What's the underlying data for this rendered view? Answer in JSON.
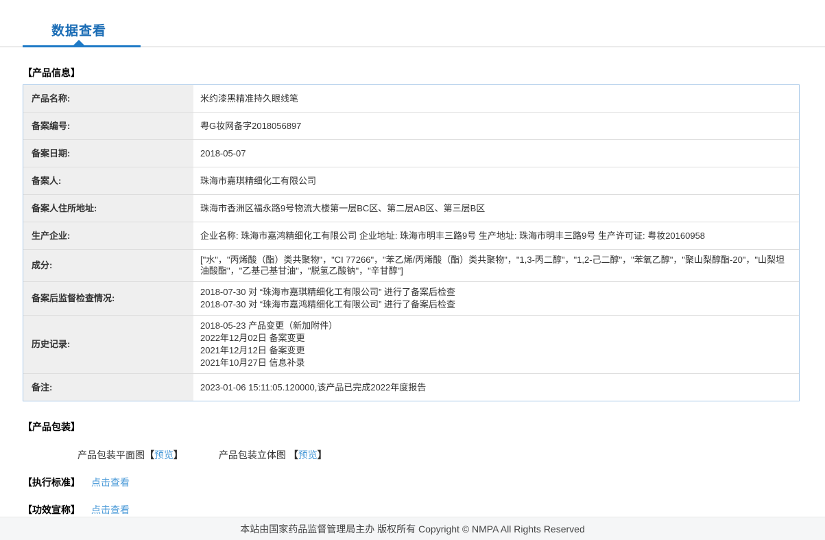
{
  "tab": {
    "label": "数据查看"
  },
  "colors": {
    "tab_blue": "#1a6cb5",
    "underline_blue": "#1f7ac6",
    "link_blue": "#4a9ad8",
    "table_border": "#a9c9e8",
    "label_bg": "#efefef",
    "row_divider": "#dddddd",
    "footer_bg": "#f5f6f7"
  },
  "product_info": {
    "section_title": "【产品信息】",
    "rows": [
      {
        "label": "产品名称:",
        "lines": [
          "米约漆黑精准持久眼线笔"
        ]
      },
      {
        "label": "备案编号:",
        "lines": [
          "粤G妆网备字2018056897"
        ]
      },
      {
        "label": "备案日期:",
        "lines": [
          "2018-05-07"
        ]
      },
      {
        "label": "备案人:",
        "lines": [
          "珠海市嘉琪精细化工有限公司"
        ]
      },
      {
        "label": "备案人住所地址:",
        "lines": [
          "珠海市香洲区福永路9号物流大楼第一层BC区、第二层AB区、第三层B区"
        ]
      },
      {
        "label": "生产企业:",
        "lines": [
          "企业名称: 珠海市嘉鸿精细化工有限公司 企业地址: 珠海市明丰三路9号 生产地址: 珠海市明丰三路9号 生产许可证: 粤妆20160958"
        ]
      },
      {
        "label": "成分:",
        "lines": [
          "[\"水\"，\"丙烯酸（酯）类共聚物\"，\"CI 77266\"，\"苯乙烯/丙烯酸（酯）类共聚物\"，\"1,3-丙二醇\"，\"1,2-己二醇\"，\"苯氧乙醇\"，\"聚山梨醇酯-20\"，\"山梨坦油酸酯\"，\"乙基己基甘油\"，\"脱氢乙酸钠\"，\"辛甘醇\"]"
        ]
      },
      {
        "label": "备案后监督检查情况:",
        "lines": [
          "2018-07-30 对 “珠海市嘉琪精细化工有限公司” 进行了备案后检查",
          "2018-07-30 对 “珠海市嘉鸿精细化工有限公司” 进行了备案后检查"
        ]
      },
      {
        "label": "历史记录:",
        "lines": [
          "2018-05-23 产品变更（新加附件）",
          "2022年12月02日 备案变更",
          "2021年12月12日 备案变更",
          "2021年10月27日 信息补录"
        ]
      },
      {
        "label": "备注:",
        "lines": [
          "2023-01-06 15:11:05.120000,该产品已完成2022年度报告"
        ]
      }
    ]
  },
  "packaging": {
    "section_title": "【产品包装】",
    "items": [
      {
        "label": "产品包装平面图",
        "bracket_open": "【",
        "link_label": "预览",
        "bracket_close": "】"
      },
      {
        "label": "产品包装立体图 ",
        "bracket_open": "【",
        "link_label": "预览",
        "bracket_close": "】"
      }
    ]
  },
  "standards": {
    "section_title": "【执行标准】",
    "link_label": "点击查看"
  },
  "efficacy": {
    "section_title": "【功效宣称】",
    "link_label": "点击查看"
  },
  "footer": {
    "text": "本站由国家药品监督管理局主办 版权所有 Copyright © NMPA All Rights Reserved"
  }
}
